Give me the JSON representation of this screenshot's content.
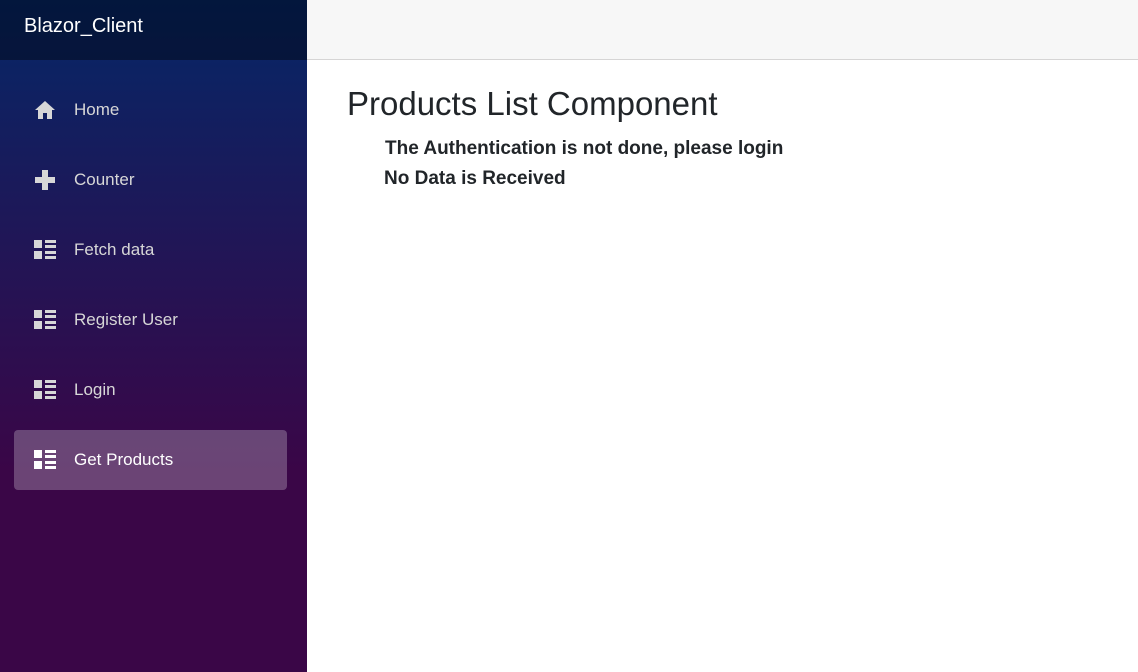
{
  "brand": {
    "title": "Blazor_Client"
  },
  "sidebar": {
    "items": [
      {
        "label": "Home",
        "icon": "home-icon",
        "active": false
      },
      {
        "label": "Counter",
        "icon": "plus-icon",
        "active": false
      },
      {
        "label": "Fetch data",
        "icon": "list-icon",
        "active": false
      },
      {
        "label": "Register User",
        "icon": "list-icon",
        "active": false
      },
      {
        "label": "Login",
        "icon": "list-icon",
        "active": false
      },
      {
        "label": "Get Products",
        "icon": "list-icon",
        "active": true
      }
    ]
  },
  "main": {
    "title": "Products List Component",
    "messages": [
      "The Authentication is not done, please login",
      "No Data is Received"
    ]
  },
  "colors": {
    "sidebar_top": "#052767",
    "sidebar_bottom": "#3a0647",
    "top_row": "#f7f7f7",
    "text": "#212529"
  }
}
